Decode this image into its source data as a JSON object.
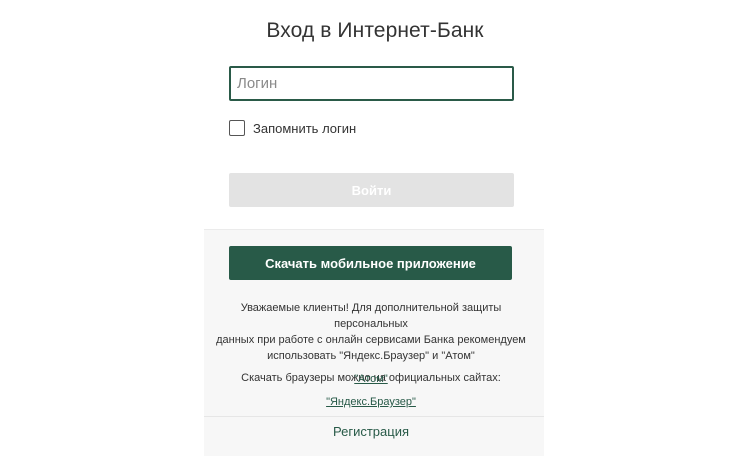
{
  "header": {
    "title": "Вход в Интернет-Банк"
  },
  "login_form": {
    "login_placeholder": "Логин",
    "login_value": "",
    "remember_label": "Запомнить логин",
    "remember_checked": false,
    "submit_label": "Войти"
  },
  "mobile": {
    "download_label": "Скачать мобильное приложение"
  },
  "notice": {
    "lines": [
      "Уважаемые клиенты! Для дополнительной защиты персональных",
      "данных при работе с онлайн сервисами Банка рекомендуем",
      "использовать \"Яндекс.Браузер\" и \"Атом\""
    ],
    "download_text": "Скачать браузеры можно на официальных сайтах:",
    "link_atom": "\"Атом\"",
    "link_yandex": "\"Яндекс.Браузер\""
  },
  "footer": {
    "register_label": "Регистрация"
  },
  "colors": {
    "brand_green": "#285a48",
    "disabled_button": "#e3e3e3"
  }
}
